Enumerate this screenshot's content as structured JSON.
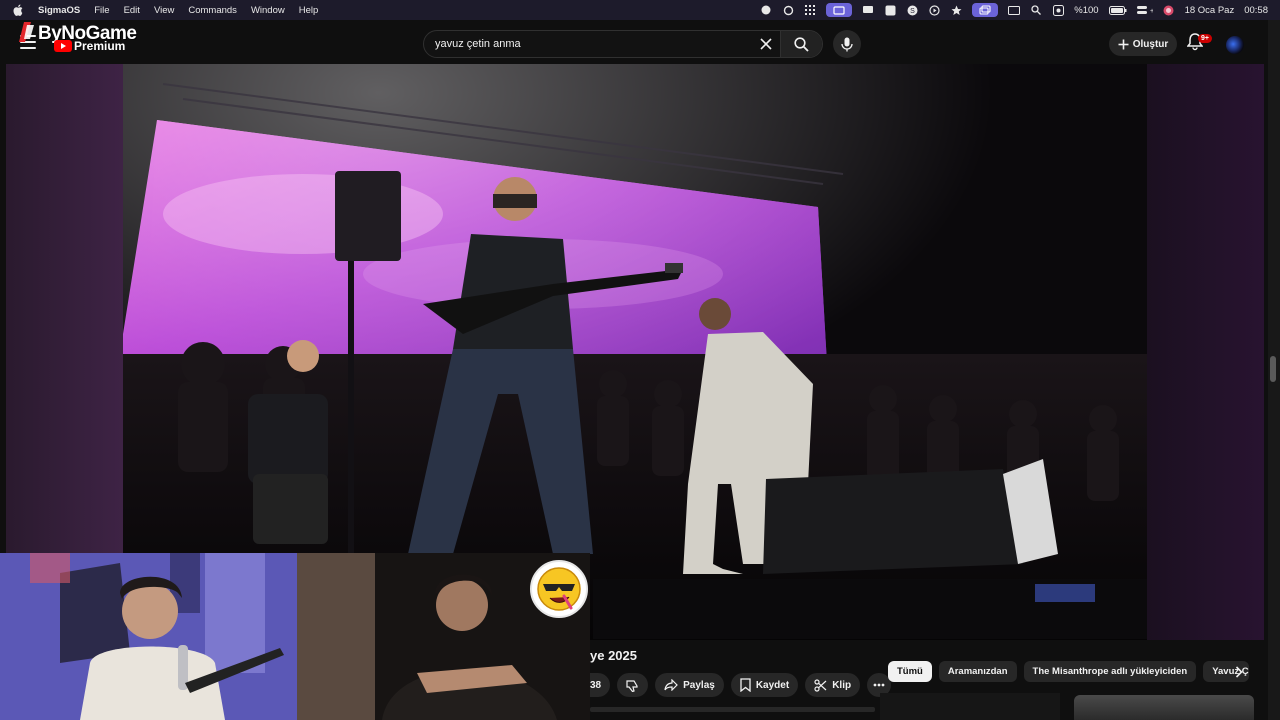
{
  "menubar": {
    "app": "SigmaOS",
    "items": [
      "File",
      "Edit",
      "View",
      "Commands",
      "Window",
      "Help"
    ],
    "battery": "%100",
    "date": "18 Oca Paz",
    "time": "00:58"
  },
  "header": {
    "logo_main": "ByNoGame",
    "logo_sub": "Premium",
    "search_value": "yavuz çetin anma",
    "create_label": "Oluştur",
    "notif_badge": "9+"
  },
  "video": {
    "title_fragment": "ye 2025",
    "like_count": "38",
    "actions": {
      "share": "Paylaş",
      "save": "Kaydet",
      "clip": "Klip"
    }
  },
  "chips": [
    "Tümü",
    "Aramanızdan",
    "The Misanthrope adlı yükleyiciden",
    "Yavuz Çe"
  ],
  "colors": {
    "background": "#0f0f0f",
    "accent_red": "#ff0000",
    "screen_magenta": "#c84ad8"
  },
  "icons": [
    "apple-icon",
    "hamburger-icon",
    "clear-icon",
    "search-icon",
    "mic-icon",
    "plus-icon",
    "bell-icon",
    "dislike-icon",
    "share-icon",
    "save-icon",
    "scissors-icon",
    "more-icon",
    "chevron-right-icon"
  ]
}
